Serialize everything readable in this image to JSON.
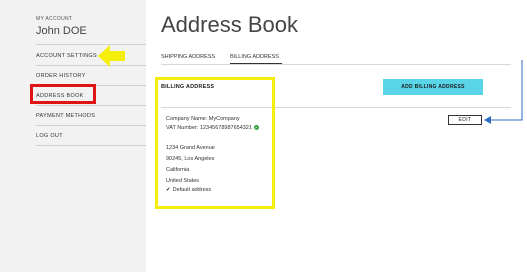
{
  "sidebar": {
    "account_label": "MY ACCOUNT",
    "account_name": "John DOE",
    "items": [
      {
        "label": "ACCOUNT SETTINGS"
      },
      {
        "label": "ORDER HISTORY"
      },
      {
        "label": "ADDRESS BOOK"
      },
      {
        "label": "PAYMENT METHODS"
      },
      {
        "label": "LOG OUT"
      }
    ]
  },
  "main": {
    "title": "Address Book",
    "tabs": [
      {
        "label": "SHIPPING ADDRESS",
        "active": false
      },
      {
        "label": "BILLING ADDRESS",
        "active": true
      }
    ],
    "section_title": "BILLING ADDRESS",
    "add_button_label": "ADD BILLING ADDRESS",
    "edit_button_label": "EDIT",
    "address": {
      "company": "Company Name: MyCompany",
      "vat": "VAT Number: 12345678987654321",
      "street": "1234 Grand Avenue",
      "city": "90245, Los Angeles",
      "state": "California",
      "country": "United States",
      "default_label": "Default address"
    }
  },
  "icons": {
    "verified": "check-circle-icon",
    "default_check": "checkmark-icon",
    "verified_char": "✔",
    "check_char": "✔"
  },
  "colors": {
    "sidebar_bg": "#f2f2f2",
    "accent_button": "#5ad5e8",
    "highlight_red": "#e01414",
    "highlight_yellow": "#f4ee0b",
    "arrow_blue": "#2e6ec0",
    "verified_green": "#2a9d3a"
  }
}
